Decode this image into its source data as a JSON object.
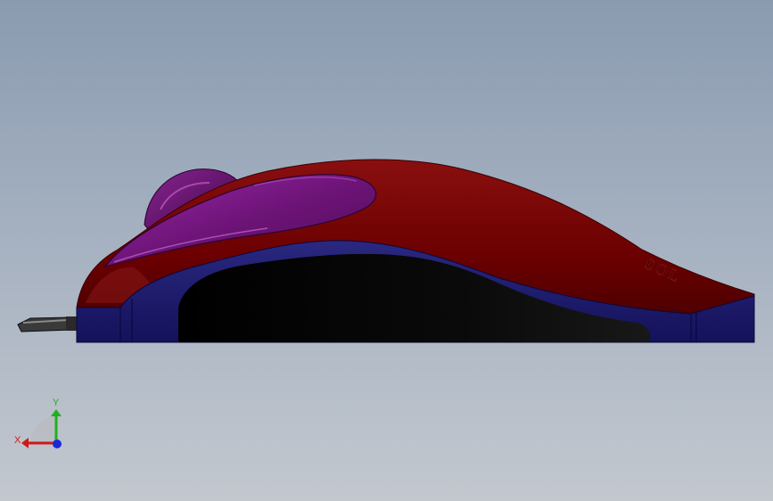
{
  "viewport": {
    "background_top": "#8a9bb0",
    "background_bottom": "#c3c8cf"
  },
  "model": {
    "body_color": "#6e0000",
    "button_color": "#7a1a86",
    "wheel_color": "#6a1472",
    "base_color": "#1c1a6a",
    "cable_color": "#3a3a3a",
    "embossed_text": "SOL"
  },
  "triad": {
    "x_label": "X",
    "y_label": "Y",
    "x_color": "#d01818",
    "y_color": "#20b020",
    "z_color": "#1a2ad8"
  }
}
